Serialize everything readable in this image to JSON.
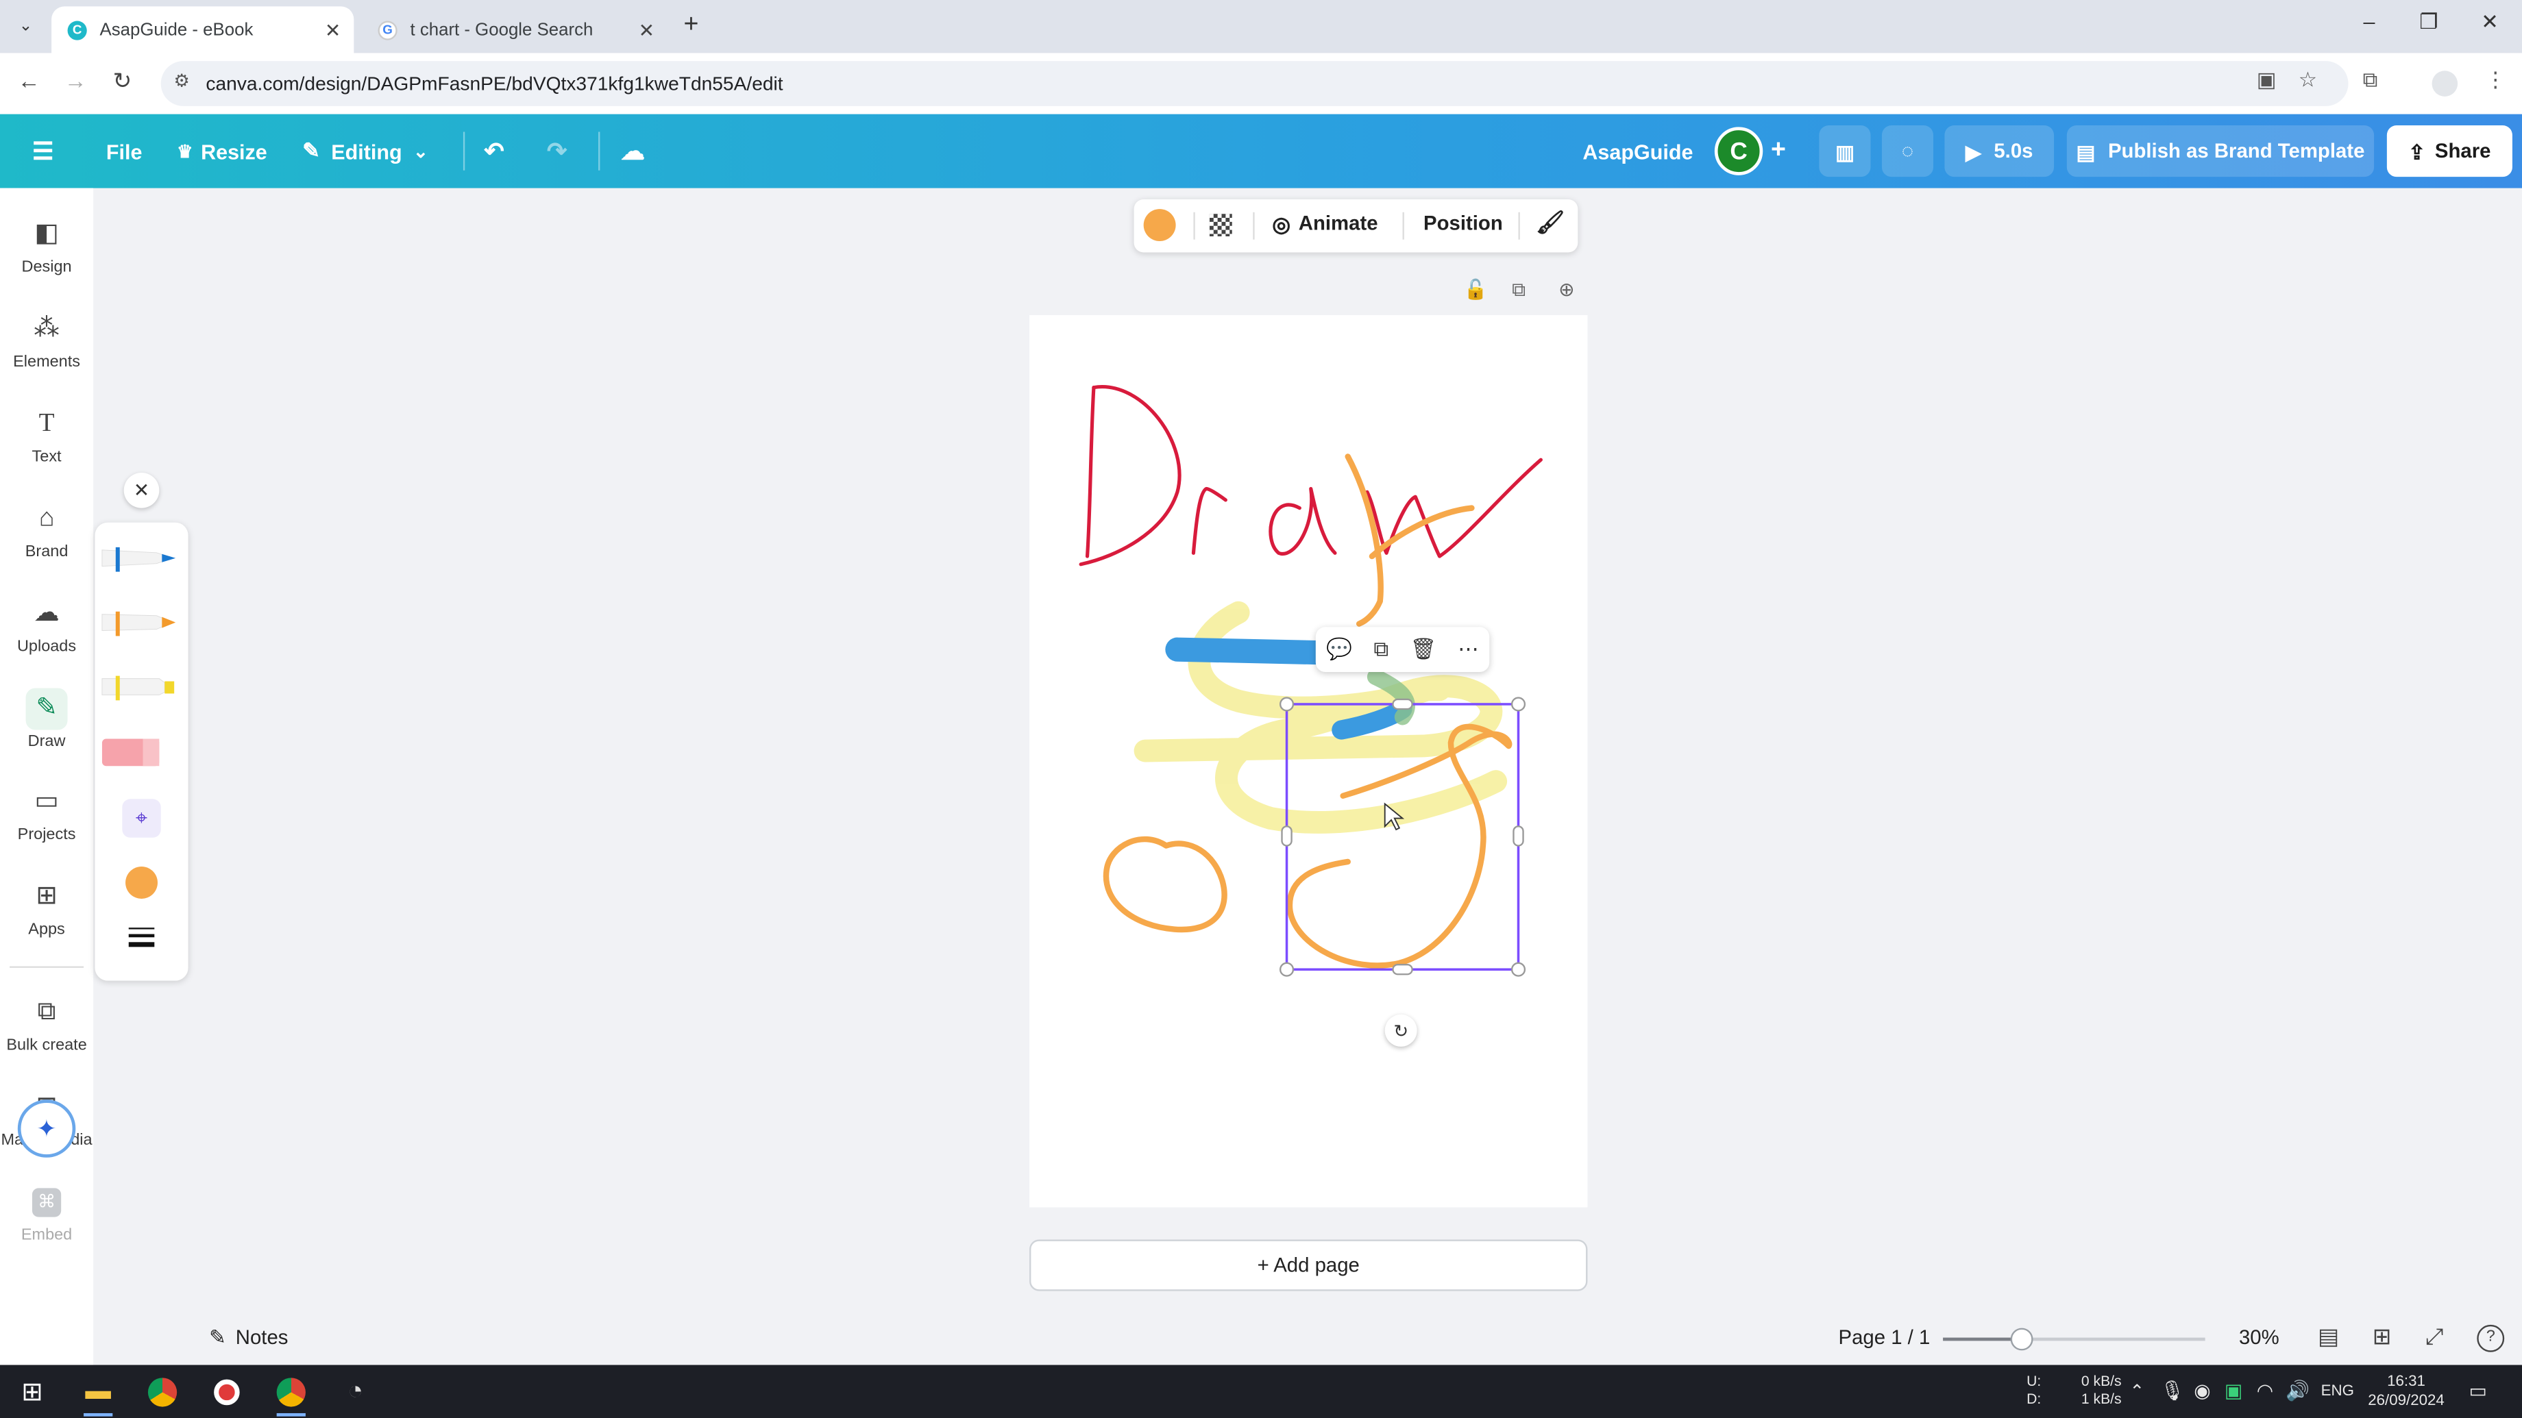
{
  "browser": {
    "tabs": [
      {
        "title": "AsapGuide - eBook",
        "active": true
      },
      {
        "title": "t chart - Google Search",
        "active": false
      }
    ],
    "url": "canva.com/design/DAGPmFasnPE/bdVQtx371kfg1kweTdn55A/edit"
  },
  "header": {
    "file_label": "File",
    "resize_label": "Resize",
    "editing_label": "Editing",
    "design_title": "AsapGuide",
    "avatar_letter": "C",
    "play_label": "5.0s",
    "publish_label": "Publish as Brand Template",
    "share_label": "Share"
  },
  "sidebar": {
    "items": [
      {
        "label": "Design",
        "icon": "design-icon"
      },
      {
        "label": "Elements",
        "icon": "elements-icon"
      },
      {
        "label": "Text",
        "icon": "text-icon"
      },
      {
        "label": "Brand",
        "icon": "brand-icon"
      },
      {
        "label": "Uploads",
        "icon": "uploads-icon"
      },
      {
        "label": "Draw",
        "icon": "draw-icon",
        "active": true
      },
      {
        "label": "Projects",
        "icon": "projects-icon"
      },
      {
        "label": "Apps",
        "icon": "apps-icon"
      },
      {
        "label": "Bulk create",
        "icon": "bulk-create-icon"
      },
      {
        "label": "Magic Media",
        "icon": "magic-media-icon"
      },
      {
        "label": "Embed",
        "icon": "embed-icon"
      }
    ]
  },
  "draw_panel": {
    "selected_color": "#f6a84a",
    "pens": [
      {
        "name": "pen",
        "color": "#1a78d0"
      },
      {
        "name": "marker",
        "color": "#f39a2b"
      },
      {
        "name": "highlighter",
        "color": "#f2d72b"
      },
      {
        "name": "eraser",
        "color": "#f6a3ab"
      }
    ]
  },
  "element_toolbar": {
    "color": "#f6a84a",
    "animate_label": "Animate",
    "position_label": "Position"
  },
  "canvas": {
    "drawn_word": "Draw",
    "colors": {
      "red": "#d81b3c",
      "orange": "#f6a84a",
      "blue": "#3b9ae0",
      "yellow": "#f6ef9d"
    }
  },
  "add_page_label": "+ Add page",
  "footer": {
    "notes_label": "Notes",
    "page_info": "Page 1 / 1",
    "zoom": "30%",
    "zoom_fraction": 0.3
  },
  "taskbar": {
    "net_up": "0 kB/s",
    "net_down": "1 kB/s",
    "net_u": "U:",
    "net_d": "D:",
    "lang": "ENG",
    "time": "16:31",
    "date": "26/09/2024"
  }
}
